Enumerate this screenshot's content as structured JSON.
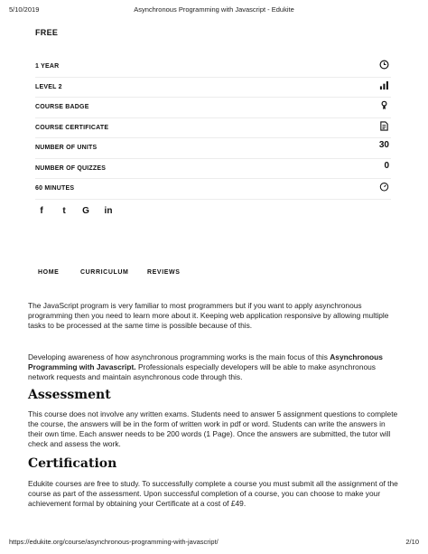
{
  "print_header": {
    "date": "5/10/2019",
    "title": "Asynchronous Programming with Javascript - Edukite"
  },
  "price_label": "FREE",
  "features": [
    {
      "label": "1 YEAR",
      "icon": "clock-icon"
    },
    {
      "label": "LEVEL 2",
      "icon": "bar-chart-icon"
    },
    {
      "label": "COURSE BADGE",
      "icon": "badge-icon"
    },
    {
      "label": "COURSE CERTIFICATE",
      "icon": "certificate-icon"
    },
    {
      "label": "NUMBER OF UNITS",
      "value": "30"
    },
    {
      "label": "NUMBER OF QUIZZES",
      "value": "0"
    },
    {
      "label": "60 MINUTES",
      "icon": "timer-icon"
    }
  ],
  "social": [
    {
      "name": "facebook-icon",
      "glyph": "f"
    },
    {
      "name": "twitter-icon",
      "glyph": "t"
    },
    {
      "name": "google-icon",
      "glyph": "G"
    },
    {
      "name": "linkedin-icon",
      "glyph": "in"
    }
  ],
  "tabs": [
    "HOME",
    "CURRICULUM",
    "REVIEWS"
  ],
  "intro": {
    "p1": "The JavaScript program is very familiar to most programmers but if you want to apply asynchronous programming then you need to learn more about it. Keeping web application responsive by allowing multiple tasks to be processed at the same time is possible because of this.",
    "p2_before": "Developing awareness of how asynchronous programming works is the main focus of this ",
    "p2_bold": "Asynchronous Programming with Javascript.",
    "p2_after": " Professionals especially developers will be able to make asynchronous network requests and maintain asynchronous code through this."
  },
  "assessment": {
    "heading": "Assessment",
    "text": "This course does not involve any written exams. Students need to answer 5 assignment questions to complete the course, the answers will be in the form of written work in pdf or word. Students can write the answers in their own time. Each answer needs to be 200 words (1 Page). Once the answers are submitted, the tutor will check and assess the work."
  },
  "certification": {
    "heading": "Certification",
    "text": "Edukite courses are free to study. To successfully complete a course you must submit all the assignment of the course as part of the assessment. Upon successful completion of a course, you can choose to make your achievement formal by obtaining your Certificate at a cost of £49."
  },
  "print_footer": {
    "url": "https://edukite.org/course/asynchronous-programming-with-javascript/",
    "page": "2/10"
  }
}
